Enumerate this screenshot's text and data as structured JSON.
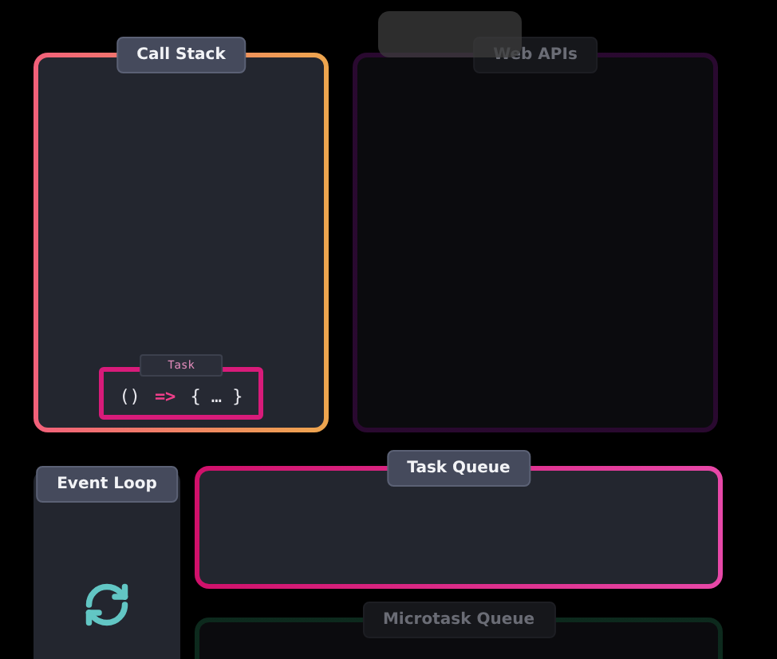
{
  "call_stack": {
    "title": "Call Stack",
    "dimmed": false,
    "task": {
      "tag": "Task",
      "code_open": "()",
      "code_arrow": "=>",
      "code_body": "{ … }"
    }
  },
  "web_apis": {
    "title": "Web APIs",
    "dimmed": true
  },
  "event_loop": {
    "title": "Event Loop"
  },
  "task_queue": {
    "title": "Task Queue",
    "dimmed": false
  },
  "microtask_queue": {
    "title": "Microtask Queue",
    "dimmed": true
  }
}
